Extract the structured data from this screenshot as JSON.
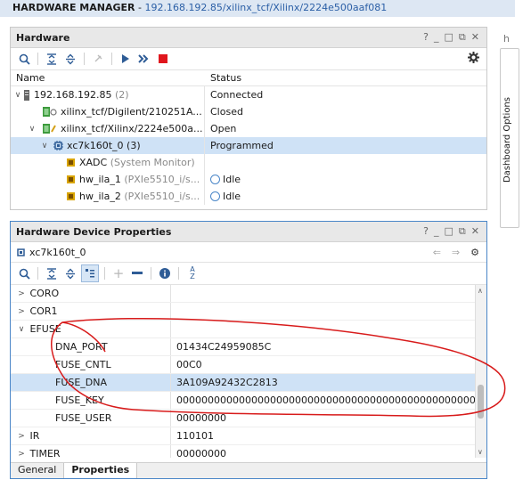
{
  "banner": {
    "label": "HARDWARE MANAGER",
    "sep": " - ",
    "path": "192.168.192.85/xilinx_tcf/Xilinx/2224e500aaf081"
  },
  "hardware_panel": {
    "title": "Hardware",
    "controls": [
      "?",
      "_",
      "□",
      "⧉",
      "✕"
    ],
    "columns": {
      "name": "Name",
      "status": "Status"
    },
    "rows": [
      {
        "name": "192.168.192.85",
        "count": "(2)",
        "status": "Connected"
      },
      {
        "name": "xilinx_tcf/Digilent/210251A...",
        "status": "Closed"
      },
      {
        "name": "xilinx_tcf/Xilinx/2224e500a...",
        "status": "Open"
      },
      {
        "name": "xc7k160t_0",
        "count": "(3)",
        "status": "Programmed"
      },
      {
        "name": "XADC",
        "detail": "(System Monitor)",
        "status": ""
      },
      {
        "name": "hw_ila_1",
        "detail": "(PXIe5510_i/s...",
        "status": "Idle"
      },
      {
        "name": "hw_ila_2",
        "detail": "(PXIe5510_i/s...",
        "status": "Idle"
      }
    ]
  },
  "properties_panel": {
    "title": "Hardware Device Properties",
    "controls": [
      "?",
      "_",
      "□",
      "⧉",
      "✕"
    ],
    "device": "xc7k160t_0",
    "rows": [
      {
        "key": "CORO",
        "value": ""
      },
      {
        "key": "COR1",
        "value": ""
      },
      {
        "key": "EFUSE",
        "value": ""
      },
      {
        "key": "DNA_PORT",
        "value": "01434C24959085C"
      },
      {
        "key": "FUSE_CNTL",
        "value": "00C0"
      },
      {
        "key": "FUSE_DNA",
        "value": "3A109A92432C2813"
      },
      {
        "key": "FUSE_KEY",
        "value": "0000000000000000000000000000000000000000000000000"
      },
      {
        "key": "FUSE_USER",
        "value": "00000000"
      },
      {
        "key": "IR",
        "value": "110101"
      },
      {
        "key": "TIMER",
        "value": "00000000"
      }
    ],
    "tabs": [
      "General",
      "Properties"
    ]
  },
  "side": {
    "tab_stub": "h",
    "dashboard_label": "Dashboard Options"
  },
  "colors": {
    "accent": "#2e5c96",
    "selection": "#cfe2f6",
    "annotation": "#d81b1b"
  }
}
